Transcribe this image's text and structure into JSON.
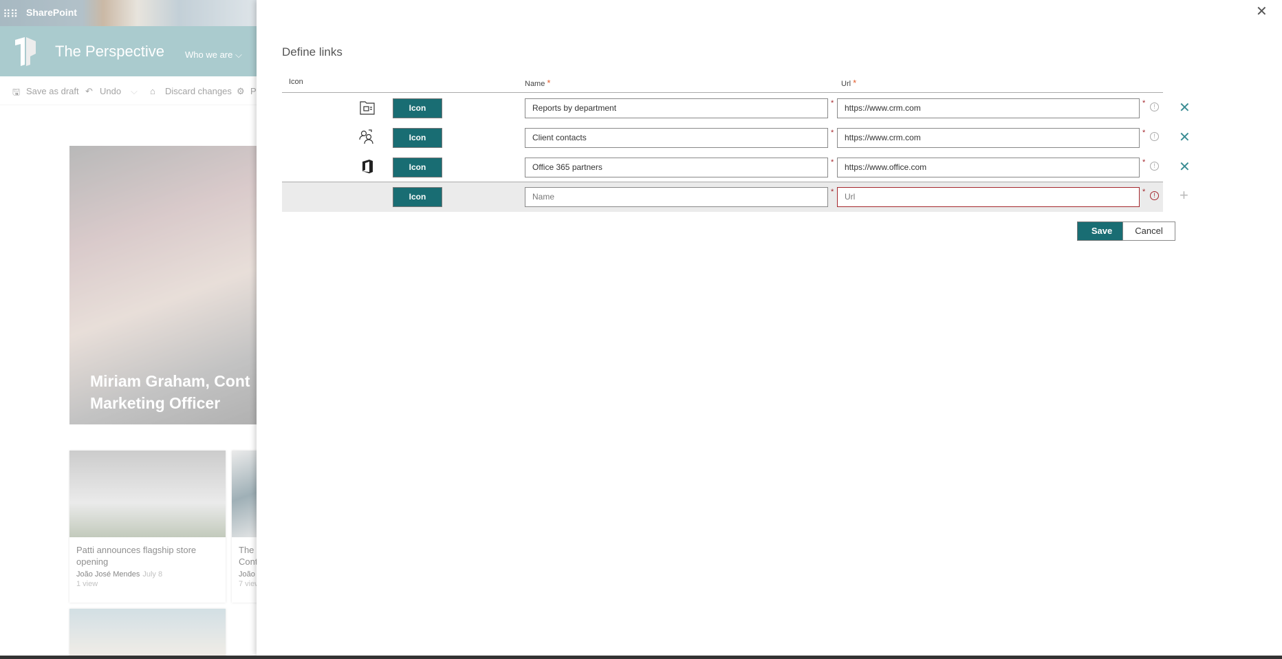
{
  "suite": {
    "app_name": "SharePoint"
  },
  "site": {
    "title": "The Perspective",
    "nav_item": "Who we are"
  },
  "command_bar": {
    "save_draft": "Save as draft",
    "undo": "Undo",
    "discard": "Discard changes",
    "page_details_partial": "P"
  },
  "hero": {
    "title": "Miriam Graham, Cont\nMarketing Officer"
  },
  "cards": [
    {
      "title": "Patti announces flagship store opening",
      "author": "João José Mendes",
      "date": "July 8",
      "views": "1 view"
    },
    {
      "title": "The ...\nCont...",
      "author": "João ...",
      "date": "",
      "views": "7 view..."
    }
  ],
  "panel": {
    "title": "Define links",
    "columns": {
      "icon": "Icon",
      "name": "Name",
      "url": "Url",
      "required_mark": "*"
    },
    "rows": [
      {
        "icon": "folder-report-icon",
        "button": "Icon",
        "name": "Reports by department",
        "url": "https://www.crm.com"
      },
      {
        "icon": "contacts-icon",
        "button": "Icon",
        "name": "Client contacts",
        "url": "https://www.crm.com"
      },
      {
        "icon": "office-logo-icon",
        "button": "Icon",
        "name": "Office 365  partners",
        "url": "https://www.office.com"
      }
    ],
    "new_row": {
      "button": "Icon",
      "name_placeholder": "Name",
      "url_placeholder": "Url"
    },
    "save": "Save",
    "cancel": "Cancel"
  },
  "colors": {
    "accent": "#196d73",
    "header": "#72a8ad",
    "error": "#a4262c"
  }
}
